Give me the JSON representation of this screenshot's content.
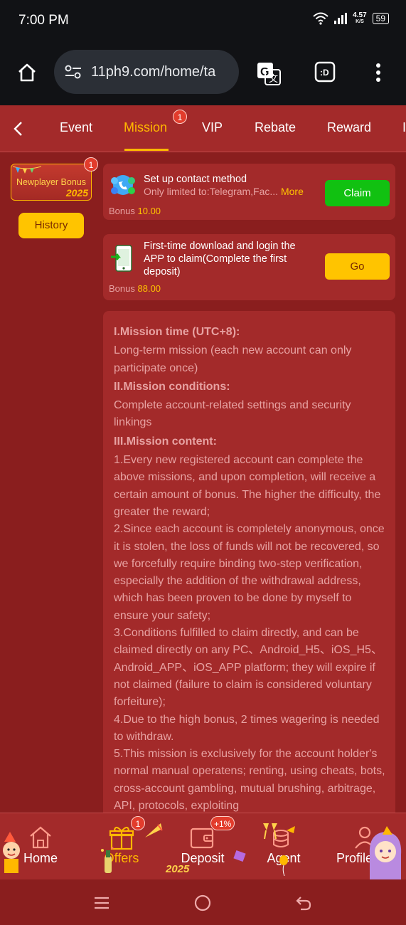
{
  "status_bar": {
    "time": "7:00 PM",
    "speed": "4.57",
    "speed_unit": "K/S",
    "battery": "59"
  },
  "browser": {
    "url": "11ph9.com/home/ta"
  },
  "tabs": [
    {
      "label": "Event",
      "active": false
    },
    {
      "label": "Mission",
      "active": true,
      "badge": "1"
    },
    {
      "label": "VIP",
      "active": false
    },
    {
      "label": "Rebate",
      "active": false
    },
    {
      "label": "Reward",
      "active": false
    },
    {
      "label": "I",
      "active": false
    }
  ],
  "sidebar": {
    "card_label": "Newplayer Bonus",
    "card_year": "2025",
    "card_badge": "1",
    "history_label": "History"
  },
  "missions": [
    {
      "title": "Set up contact method",
      "subtitle": "Only limited to:Telegram,Fac...",
      "more": "More",
      "bonus_label": "Bonus",
      "bonus_value": "10.00",
      "action": "Claim"
    },
    {
      "title": "First-time download and login the APP to claim(Complete the first deposit)",
      "bonus_label": "Bonus",
      "bonus_value": "88.00",
      "action": "Go"
    }
  ],
  "rules": {
    "h1": "I.Mission time (UTC+8):",
    "p1": "Long-term mission (each new account can only participate once)",
    "h2": "II.Mission conditions:",
    "p2": "Complete account-related settings and security linkings",
    "h3": "III.Mission content:",
    "p3": "1.Every new registered account can complete the above missions, and upon completion, will receive a certain amount of bonus. The higher the difficulty, the greater the reward;",
    "p4": "2.Since each account is completely anonymous, once it is stolen, the loss of funds will not be recovered, so we forcefully require binding two-step verification, especially the addition of the withdrawal address, which has been proven to be done by myself to ensure your safety;",
    "p5": "3.Conditions fulfilled to claim directly, and can be claimed directly on any PC、Android_H5、iOS_H5、Android_APP、iOS_APP platform; they will expire if not claimed (failure to claim is considered voluntary forfeiture);",
    "p6": "4.Due to the high bonus, 2 times wagering is needed to withdraw.",
    "p7": "5.This mission is exclusively for the account holder's normal manual operatens; renting, using cheats, bots, cross-account gambling, mutual brushing, arbitrage, API, protocols, exploiting"
  },
  "bottom_nav": [
    {
      "label": "Home",
      "active": false
    },
    {
      "label": "Offers",
      "active": true,
      "badge": "1"
    },
    {
      "label": "Deposit",
      "active": false,
      "badge": "+1%"
    },
    {
      "label": "Agent",
      "active": false
    },
    {
      "label": "Profile",
      "active": false
    }
  ],
  "nav_decoration_year": "2025",
  "colors": {
    "accent": "#ffb800",
    "background": "#8a1e1e",
    "panel": "#a32a2a",
    "claim": "#11c111"
  }
}
